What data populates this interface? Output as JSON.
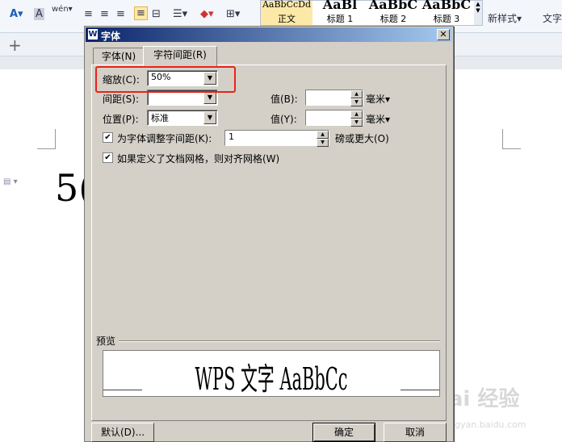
{
  "ribbon": {
    "styles": [
      {
        "sample": "AaBbCcDd",
        "name": "正文"
      },
      {
        "sample": "AaBl",
        "name": "标题 1"
      },
      {
        "sample": "AaBbC",
        "name": "标题 2"
      },
      {
        "sample": "AaBbC",
        "name": "标题 3"
      }
    ],
    "new_style_label": "新样式",
    "text_tool_label": "文字"
  },
  "document": {
    "text": "5("
  },
  "dialog": {
    "title": "字体",
    "tabs": [
      {
        "label": "字体(N)",
        "active": false
      },
      {
        "label": "字符间距(R)",
        "active": true
      }
    ],
    "scale": {
      "label": "缩放(C):",
      "value": "50%"
    },
    "spacing": {
      "label": "间距(S):",
      "value": "",
      "value_label": "值(B):",
      "unit": "毫米"
    },
    "spacing_value": {
      "label": "值(B):",
      "value": "",
      "unit": "毫米▾"
    },
    "position": {
      "label": "位置(P):",
      "value": "标准"
    },
    "position_value": {
      "label": "值(Y):",
      "value": "",
      "unit": "毫米▾"
    },
    "kerning": {
      "label": "为字体调整字间距(K):",
      "value": "1",
      "suffix": "磅或更大(O)",
      "checked": true
    },
    "grid": {
      "label": "如果定义了文档网格，则对齐网格(W)",
      "checked": true
    },
    "preview_label": "预览",
    "preview_text": "WPS 文字 AaBbCc",
    "buttons": {
      "default": "默认(D)...",
      "ok": "确定",
      "cancel": "取消"
    }
  },
  "watermark": {
    "text": "Bai 经验",
    "sub": "jingyan.baidu.com"
  }
}
